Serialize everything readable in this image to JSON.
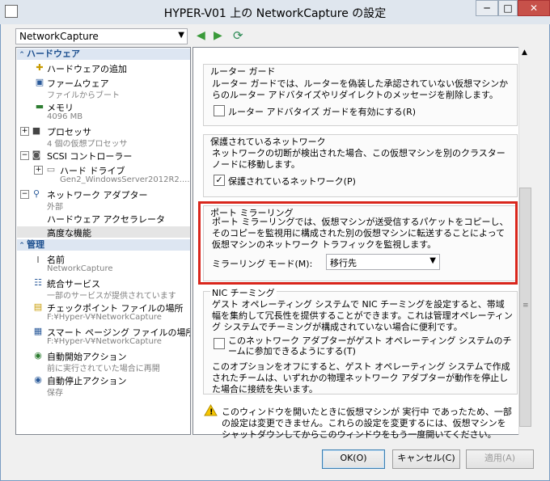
{
  "window": {
    "title": "HYPER-V01 上の NetworkCapture の設定",
    "controls": [
      "─",
      "□",
      "✕"
    ]
  },
  "vm_selector": {
    "value": "NetworkCapture"
  },
  "nav_icons": [
    "back-arrow-icon",
    "forward-arrow-icon",
    "refresh-icon"
  ],
  "tree": {
    "hardware_section": "ハードウェア",
    "items": {
      "add_hardware": "ハードウェアの追加",
      "firmware": "ファームウェア",
      "firmware_sub": "ファイルからブート",
      "memory": "メモリ",
      "memory_sub": "4096 MB",
      "processor": "プロセッサ",
      "processor_sub": "4 個の仮想プロセッサ",
      "scsi": "SCSI コントローラー",
      "hard_drive": "ハード ドライブ",
      "hard_drive_sub": "Gen2_WindowsServer2012R2....",
      "network_adapter": "ネットワーク アダプター",
      "network_adapter_sub": "外部",
      "hw_acceleration": "ハードウェア アクセラレータ",
      "advanced": "高度な機能"
    },
    "management_section": "管理",
    "mgmt": {
      "name": "名前",
      "name_sub": "NetworkCapture",
      "integration": "統合サービス",
      "integration_sub": "一部のサービスが提供されています",
      "checkpoint": "チェックポイント ファイルの場所",
      "checkpoint_sub": "F:¥Hyper-V¥NetworkCapture",
      "paging": "スマート ページング ファイルの場所",
      "paging_sub": "F:¥Hyper-V¥NetworkCapture",
      "autostart": "自動開始アクション",
      "autostart_sub": "前に実行されていた場合に再開",
      "autostop": "自動停止アクション",
      "autostop_sub": "保存"
    }
  },
  "router_guard": {
    "title": "ルーター ガード",
    "text": "ルーター ガードでは、ルーターを偽装した承認されていない仮想マシンからのルーター アドバタイズやリダイレクトのメッセージを削除します。",
    "checkbox_label": "ルーター アドバタイズ ガードを有効にする(R)",
    "checked": false
  },
  "protected_network": {
    "title": "保護されているネットワーク",
    "text": "ネットワークの切断が検出された場合、この仮想マシンを別のクラスター ノードに移動します。",
    "checkbox_label": "保護されているネットワーク(P)",
    "checked": true
  },
  "port_mirroring": {
    "title": "ポート ミラーリング",
    "text": "ポート ミラーリングでは、仮想マシンが送受信するパケットをコピーし、そのコピーを監視用に構成された別の仮想マシンに転送することによって仮想マシンのネットワーク トラフィックを監視します。",
    "mode_label": "ミラーリング モード(M):",
    "mode_value": "移行先"
  },
  "nic_teaming": {
    "title": "NIC チーミング",
    "text": "ゲスト オペレーティング システムで NIC チーミングを設定すると、帯域幅を集約して冗長性を提供することができます。これは管理オペレーティング システムでチーミングが構成されていない場合に便利です。",
    "checkbox_label": "このネットワーク アダプターがゲスト オペレーティング システムのチームに参加できるようにする(T)",
    "checked": false,
    "note": "このオプションをオフにすると、ゲスト オペレーティング システムで作成されたチームは、いずれかの物理ネットワーク アダプターが動作を停止した場合に接続を失います。"
  },
  "warning": {
    "text": "このウィンドウを開いたときに仮想マシンが 実行中 であったため、一部の設定は変更できません。これらの設定を変更するには、仮想マシンをシャットダウンしてからこのウィンドウをもう一度開いてください。"
  },
  "buttons": {
    "ok": "OK(O)",
    "cancel": "キャンセル(C)",
    "apply": "適用(A)"
  },
  "colors": {
    "accent": "#1c4f8f",
    "highlight_border": "#d9261c",
    "section_bg": "#dde6f2"
  }
}
